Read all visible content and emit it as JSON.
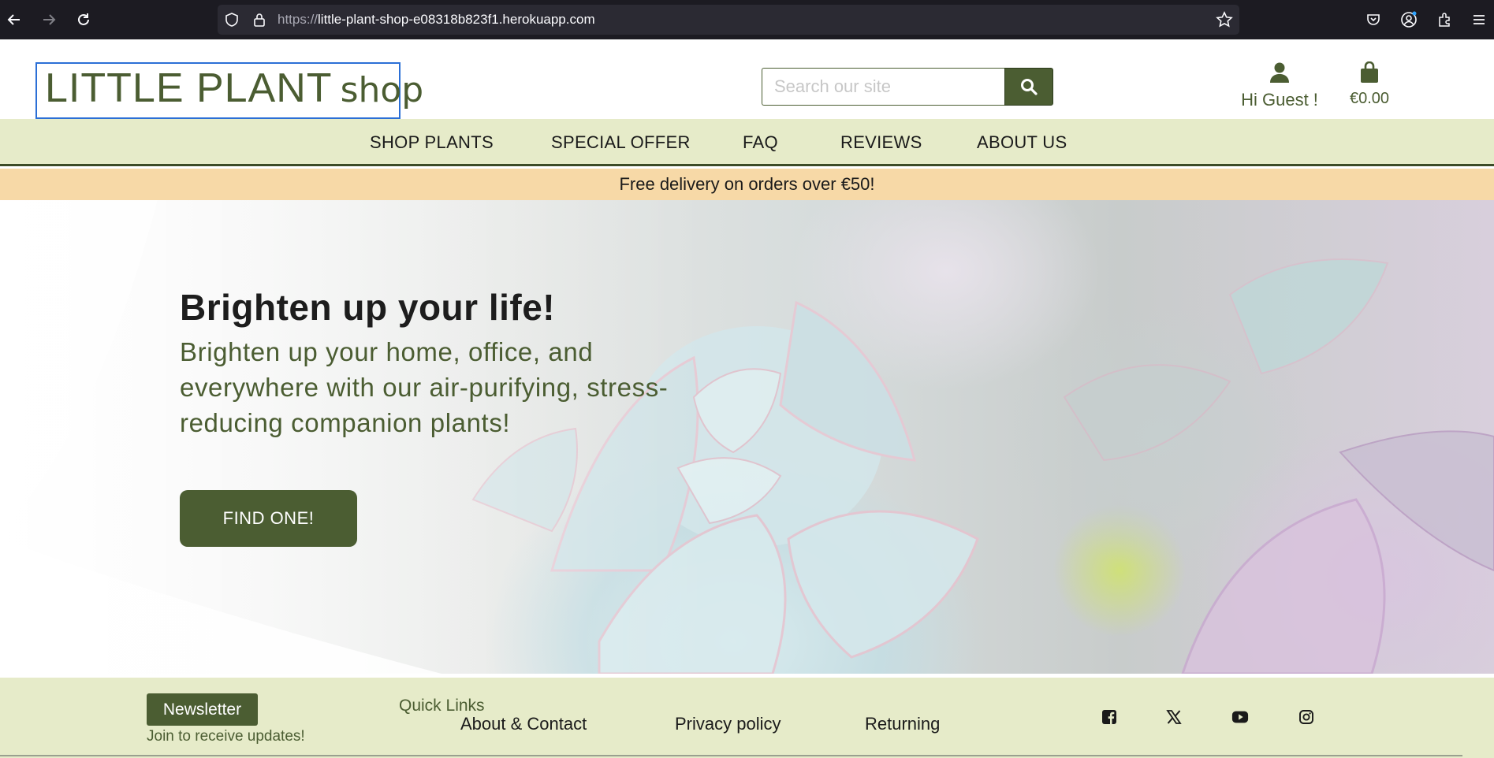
{
  "browser": {
    "url_scheme": "https://",
    "url_host": "little-plant-shop-e08318b823f1.herokuapp.com",
    "icons": [
      "back-icon",
      "forward-icon",
      "reload-icon",
      "shield-icon",
      "lock-icon",
      "star-icon",
      "pocket-icon",
      "account-icon",
      "extensions-icon",
      "menu-icon"
    ]
  },
  "header": {
    "logo_main": "LITTLE PLANT",
    "logo_sub": "shop",
    "search_placeholder": "Search our site",
    "account_label": "Hi Guest !",
    "cart_total": "€0.00"
  },
  "nav": {
    "items": [
      "SHOP PLANTS",
      "SPECIAL OFFER",
      "FAQ",
      "REVIEWS",
      "ABOUT US"
    ]
  },
  "banner": {
    "text": "Free delivery on orders over €50!"
  },
  "hero": {
    "title": "Brighten up your life!",
    "subtitle": "Brighten up your home, office, and everywhere with our air-purifying, stress-reducing companion plants!",
    "button": "FIND ONE!"
  },
  "footer": {
    "newsletter_label": "Newsletter",
    "newsletter_note": "Join to receive updates!",
    "quick_links_title": "Quick Links",
    "links": [
      "About & Contact",
      "Privacy policy",
      "Returning"
    ],
    "social_icons": [
      "facebook-icon",
      "x-icon",
      "youtube-icon",
      "instagram-icon"
    ]
  },
  "colors": {
    "brand_green": "#4b5d32",
    "nav_bg": "#e6ebc9",
    "banner_bg": "#f7d9a7"
  }
}
